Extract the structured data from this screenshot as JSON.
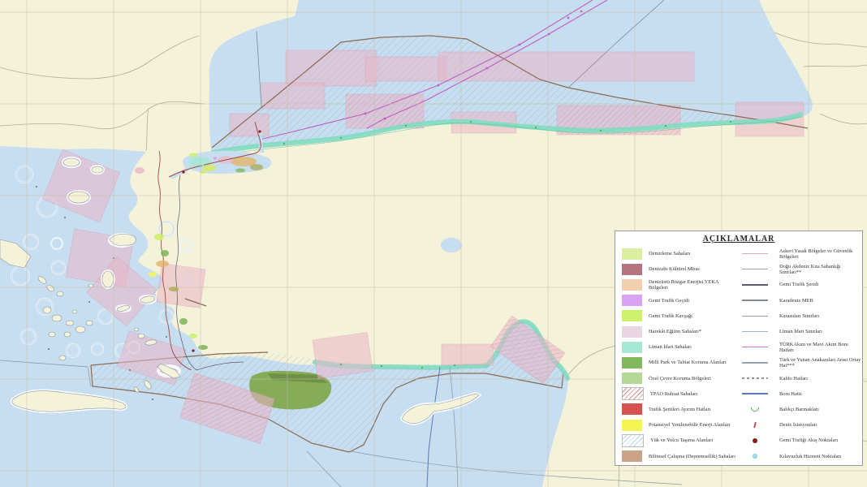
{
  "legend": {
    "title": "AÇIKLAMALAR",
    "left_items": [
      {
        "label": "Demirleme Sahaları",
        "swatch": "solid",
        "color": "#dcee9f"
      },
      {
        "label": "Denizaltı Kültürel Miras",
        "swatch": "solid",
        "color": "#b5737e"
      },
      {
        "label": "Denizüstü Rüzgar Enerjisi YEKA Bölgeleri",
        "swatch": "solid",
        "color": "#f1d0af"
      },
      {
        "label": "Gemi Trafik Geçidi",
        "swatch": "solid",
        "color": "#d9a2f2"
      },
      {
        "label": "Gemi Trafik Kavşağı",
        "swatch": "solid",
        "color": "#cdf06d"
      },
      {
        "label": "Harekât Eğitim Sahaları*",
        "swatch": "solid",
        "color": "#ead5e2"
      },
      {
        "label": "Liman İdari Sahaları",
        "swatch": "solid",
        "color": "#a7e7d6"
      },
      {
        "label": "Milli Park ve Tabiat Koruma Alanları",
        "swatch": "solid",
        "color": "#83b75e"
      },
      {
        "label": "Özel Çevre Koruma Bölgeleri",
        "swatch": "solid",
        "color": "#b4d996"
      },
      {
        "label": "TPAO Ruhsat Sahaları",
        "swatch": "hatch",
        "color": "#d49090"
      },
      {
        "label": "Trafik Şeritleri Ayırım Hatları",
        "swatch": "solid",
        "color": "#d5534f"
      },
      {
        "label": "Potansiyel Yenilenebilir Enerji Alanları",
        "swatch": "solid",
        "color": "#f4f455"
      },
      {
        "label": "Yük ve Yolcu Taşıma Alanları",
        "swatch": "hatch",
        "color": "#b8d4ea"
      },
      {
        "label": "Bilimsel Çalışma (Depremsellik) Sahaları",
        "swatch": "solid",
        "color": "#c9a288"
      }
    ],
    "right_items": [
      {
        "label": "Askeri Yasak Bölgeler ve Güvenlik Bölgeleri",
        "marker": "line",
        "color": "#e3a8b8"
      },
      {
        "label": "Doğu Akdeniz Kıta Sahanlığı Sınırları**",
        "marker": "line",
        "color": "#9aa2ab"
      },
      {
        "label": "Gemi Trafik Şeridi",
        "marker": "thick-line",
        "color": "#555a64"
      },
      {
        "label": "Karadeniz MEB",
        "marker": "line",
        "color": "#848b96"
      },
      {
        "label": "Karasuları Sınırları",
        "marker": "line",
        "color": "#98a0a8"
      },
      {
        "label": "Liman İdari Sınırları",
        "marker": "line",
        "color": "#9fb4c2"
      },
      {
        "label": "TÜRKAkım ve Mavi Akım Boru Hatları",
        "marker": "line",
        "color": "#c878cc"
      },
      {
        "label": "Türk ve Yunan Anakaraları Arası Ortay Hat***",
        "marker": "line",
        "color": "#9aa2ab"
      },
      {
        "label": "Kablo Hatları",
        "marker": "dashed-line",
        "color": "#8b939b"
      },
      {
        "label": "Boru Hattı",
        "marker": "thick-line",
        "color": "#5b79b2"
      },
      {
        "label": "Balıkçı Barınakları",
        "marker": "arc",
        "color": "#5aa85c"
      },
      {
        "label": "Deniz İstasyonları",
        "marker": "tick",
        "color": "#c0504d"
      },
      {
        "label": "Gemi Trafiği Akış Noktaları",
        "marker": "dot",
        "color": "#8b1a1a"
      },
      {
        "label": "Kılavuzluk Hizmeti Noktaları",
        "marker": "small-dot",
        "color": "#a8dde8"
      }
    ]
  },
  "map": {
    "colors": {
      "land": "#f5f2da",
      "sea": "#c6def0",
      "coastal_band": "#7fdac0",
      "military_zone": "#e9b7c7",
      "military_edge": "#d493ab",
      "eez_line": "#8a6a52",
      "meb_line": "#7f8a96",
      "pipeline_magenta": "#c25ec2",
      "pipeline_blue": "#5b79b2",
      "traffic_red": "#a2483d",
      "median_line": "#9a4a42",
      "green_zone": "#7aa33f",
      "green_zone_dark": "#5f7f33",
      "grid_line": "#c4beab",
      "country_border": "#b3ab93",
      "island_outline": "#8a96a4",
      "contour_ring": "#aac4da",
      "lane_dark": "#5a5a66",
      "sea_hatch": "#8fa3b5",
      "hatch_pink": "#cf8fa6",
      "orange_patch": "#e2b36a",
      "yellow_patch": "#e8e96a",
      "olive_patch": "#a8a84f",
      "legend_background": "#ffffff"
    }
  }
}
